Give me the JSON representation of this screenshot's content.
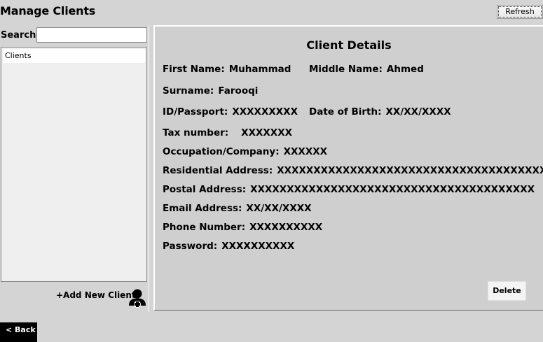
{
  "header": {
    "title": "Manage Clients",
    "refresh_label": "Refresh"
  },
  "sidebar": {
    "search_label": "Search",
    "search_value": "",
    "list_items": [
      "Clients"
    ],
    "add_client_label": "+Add New Client"
  },
  "details": {
    "heading": "Client Details",
    "first_name": {
      "label": "First Name:",
      "value": "Muhammad"
    },
    "middle_name": {
      "label": "Middle Name:",
      "value": "Ahmed"
    },
    "surname": {
      "label": "Surname:",
      "value": "Farooqi"
    },
    "id_passport": {
      "label": "ID/Passport:",
      "value": "XXXXXXXXX"
    },
    "dob": {
      "label": "Date of Birth:",
      "value": "XX/XX/XXXX"
    },
    "tax_number": {
      "label": "Tax number:",
      "value": "XXXXXXX"
    },
    "occupation": {
      "label": "Occupation/Company:",
      "value": "XXXXXX"
    },
    "residential_address": {
      "label": "Residential Address:",
      "value": "XXXXXXXXXXXXXXXXXXXXXXXXXXXXXXXXXXXXXXX"
    },
    "postal_address": {
      "label": "Postal Address:",
      "value": "XXXXXXXXXXXXXXXXXXXXXXXXXXXXXXXXXXXXXXX"
    },
    "email_address": {
      "label": "Email Address:",
      "value": "XX/XX/XXXX"
    },
    "phone_number": {
      "label": "Phone Number:",
      "value": "XXXXXXXXXX"
    },
    "password": {
      "label": "Password:",
      "value": "XXXXXXXXXX"
    },
    "delete_label": "Delete"
  },
  "footer": {
    "back_label": "< Back"
  },
  "icons": {
    "add_client": "add-user-icon"
  }
}
